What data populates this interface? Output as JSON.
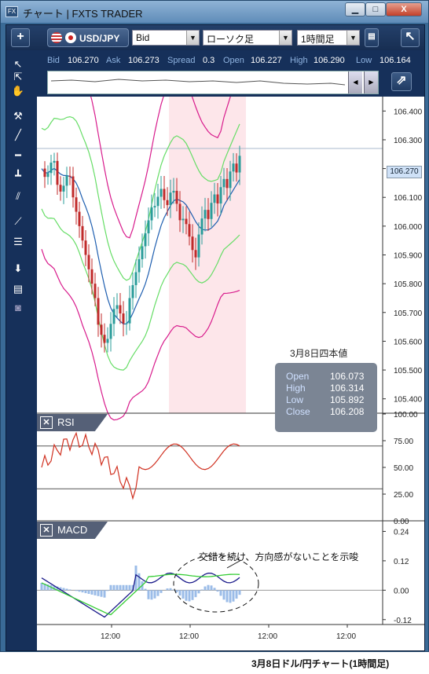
{
  "window": {
    "title": "チャート | FXTS TRADER",
    "app_icon": "FX",
    "min": "▁",
    "max": "□",
    "close": "X"
  },
  "toolbar": {
    "add": "+",
    "symbol": "USD/JPY",
    "price_type": "Bid",
    "chart_type": "ローソク足",
    "timeframe": "1時間足",
    "undock": "↖"
  },
  "quote": {
    "bid_label": "Bid",
    "bid": "106.270",
    "ask_label": "Ask",
    "ask": "106.273",
    "spread_label": "Spread",
    "spread": "0.3",
    "open_label": "Open",
    "open": "106.227",
    "high_label": "High",
    "high": "106.290",
    "low_label": "Low",
    "low": "106.164"
  },
  "rsi_panel": {
    "label": "RSI",
    "close": "✕"
  },
  "macd_panel": {
    "label": "MACD",
    "close": "✕"
  },
  "ohlc_box": {
    "title": "3月8日四本値",
    "open_label": "Open",
    "open": "106.073",
    "high_label": "High",
    "high": "106.314",
    "low_label": "Low",
    "low": "105.892",
    "close_label": "Close",
    "close": "106.208"
  },
  "annotation": "交錯を続け、方向感がないことを示唆",
  "caption": "3月8日ドル/円チャート(1時間足)",
  "price_tag": "106.270",
  "colors": {
    "up": "#2a9c9a",
    "down": "#c02a2a",
    "bb_outer": "#d81b8c",
    "bb_inner": "#66dd66",
    "ma": "#1f5fb0",
    "rsi": "#d03020",
    "macd": "#1a1a8a",
    "signal": "#33cc33",
    "hist": "#9bbce8",
    "highlight": "#fde6ea"
  },
  "chart_data": [
    {
      "type": "candlestick",
      "yaxis_ticks": [
        "106.400",
        "106.300",
        "106.200",
        "106.100",
        "106.000",
        "105.900",
        "105.800",
        "105.700",
        "105.600",
        "105.500",
        "105.400"
      ],
      "ylim": [
        105.35,
        106.45
      ],
      "xaxis_ticks": [
        "12:00",
        "12:00",
        "12:00",
        "12:00"
      ],
      "current_price": 106.27
    },
    {
      "type": "line",
      "name": "RSI",
      "yaxis_ticks": [
        "100.00",
        "75.00",
        "50.00",
        "25.00",
        "0.00"
      ],
      "ylim": [
        0,
        100
      ],
      "levels": [
        70,
        30
      ]
    },
    {
      "type": "line",
      "name": "MACD",
      "yaxis_ticks": [
        "0.24",
        "0.12",
        "0.00",
        "-0.12"
      ],
      "ylim": [
        -0.14,
        0.28
      ]
    }
  ]
}
